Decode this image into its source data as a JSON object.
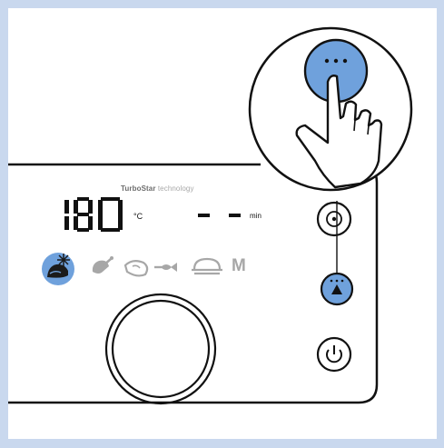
{
  "panel": {
    "brand_name": "TurboStar",
    "brand_suffix": "technology"
  },
  "display": {
    "temperature": "180",
    "temperature_unit": "°C",
    "time": "- -",
    "time_unit": "min"
  },
  "modes": {
    "active": "frozen-food",
    "items": [
      "frozen-food-icon",
      "drumstick-icon",
      "steak-icon",
      "fish-icon",
      "cake-icon"
    ],
    "manual_label": "M"
  },
  "colors": {
    "accent_blue": "#6fa1dc",
    "inactive_icon": "#a7a7a7",
    "background_border": "#c9d8ee"
  },
  "callout": {
    "icon": "hand-pointer-icon",
    "target": "preset-button",
    "button_symbol": "···"
  }
}
